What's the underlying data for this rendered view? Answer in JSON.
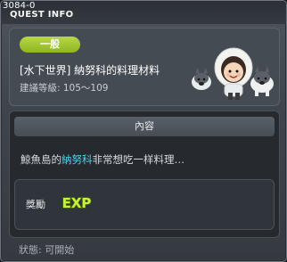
{
  "window": {
    "quest_id": "3084-0",
    "title": "QUEST INFO"
  },
  "quest": {
    "category": "一般",
    "name": "[水下世界] 納努科的料理材料",
    "recommended_level": "建議等級: 105～109"
  },
  "content": {
    "header": "內容",
    "description_prefix": "鯨魚島的",
    "description_highlight": "納努科",
    "description_suffix": "非常想吃一样料理…",
    "highlight_color": "#4fd4e6"
  },
  "reward": {
    "label": "獎勵",
    "icon": "exp-icon",
    "icon_text": "EXP"
  },
  "status": {
    "text": "狀態:  可開始"
  },
  "colors": {
    "badge": "#a3c935",
    "panel": "#454b52",
    "content_bg": "#262a2f"
  }
}
